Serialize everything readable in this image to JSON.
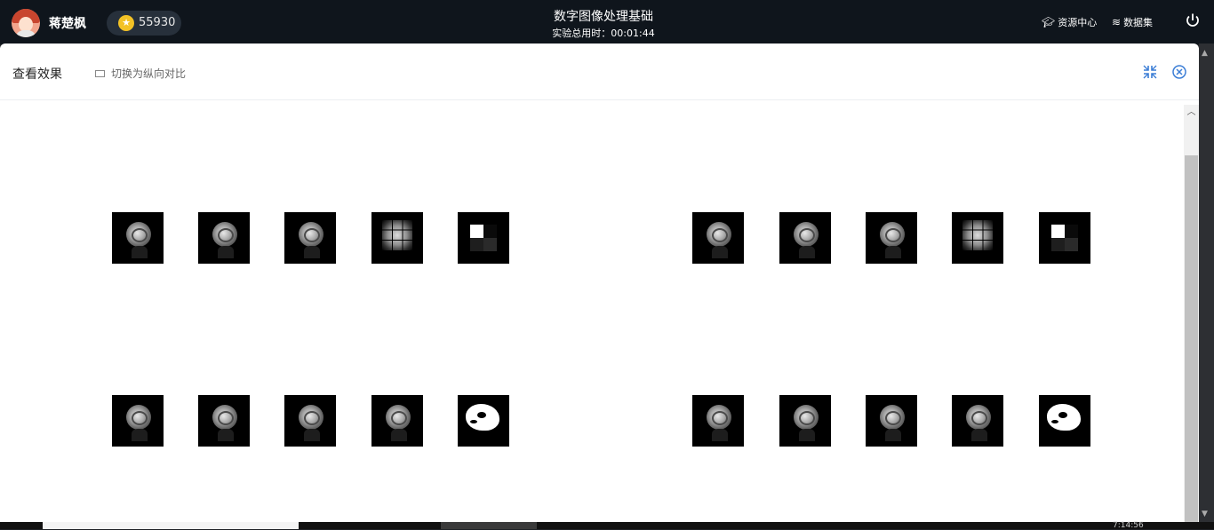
{
  "user": {
    "name": "蒋楚枫",
    "coins": "55930"
  },
  "header": {
    "title": "数字图像处理基础",
    "timer": "实验总用时：00:01:44"
  },
  "nav": {
    "resources": "资源中心",
    "datasets": "数据集"
  },
  "dialog": {
    "title": "查看效果",
    "switch_label": "切换为纵向对比"
  },
  "taskbar": {
    "time": "7:14:56"
  },
  "colors": {
    "topbar": "#0f151c",
    "accent_icon": "#3c7ed6",
    "coin": "#f3c226"
  },
  "icons": [
    "user-avatar",
    "coin-icon",
    "graduation-cap-icon",
    "layers-icon",
    "power-icon",
    "layout-icon",
    "collapse-icon",
    "close-circle-icon",
    "chevron-up-icon"
  ],
  "tiles": {
    "left_top": [
      "rose",
      "rose",
      "rose",
      "pixelated-rose",
      "dct-blocks"
    ],
    "right_top": [
      "rose",
      "rose",
      "rose",
      "pixelated-rose",
      "dct-blocks"
    ],
    "left_bottom": [
      "rose",
      "rose",
      "rose",
      "rose",
      "binary-rose"
    ],
    "right_bottom": [
      "rose",
      "rose",
      "rose",
      "rose",
      "binary-rose"
    ]
  }
}
